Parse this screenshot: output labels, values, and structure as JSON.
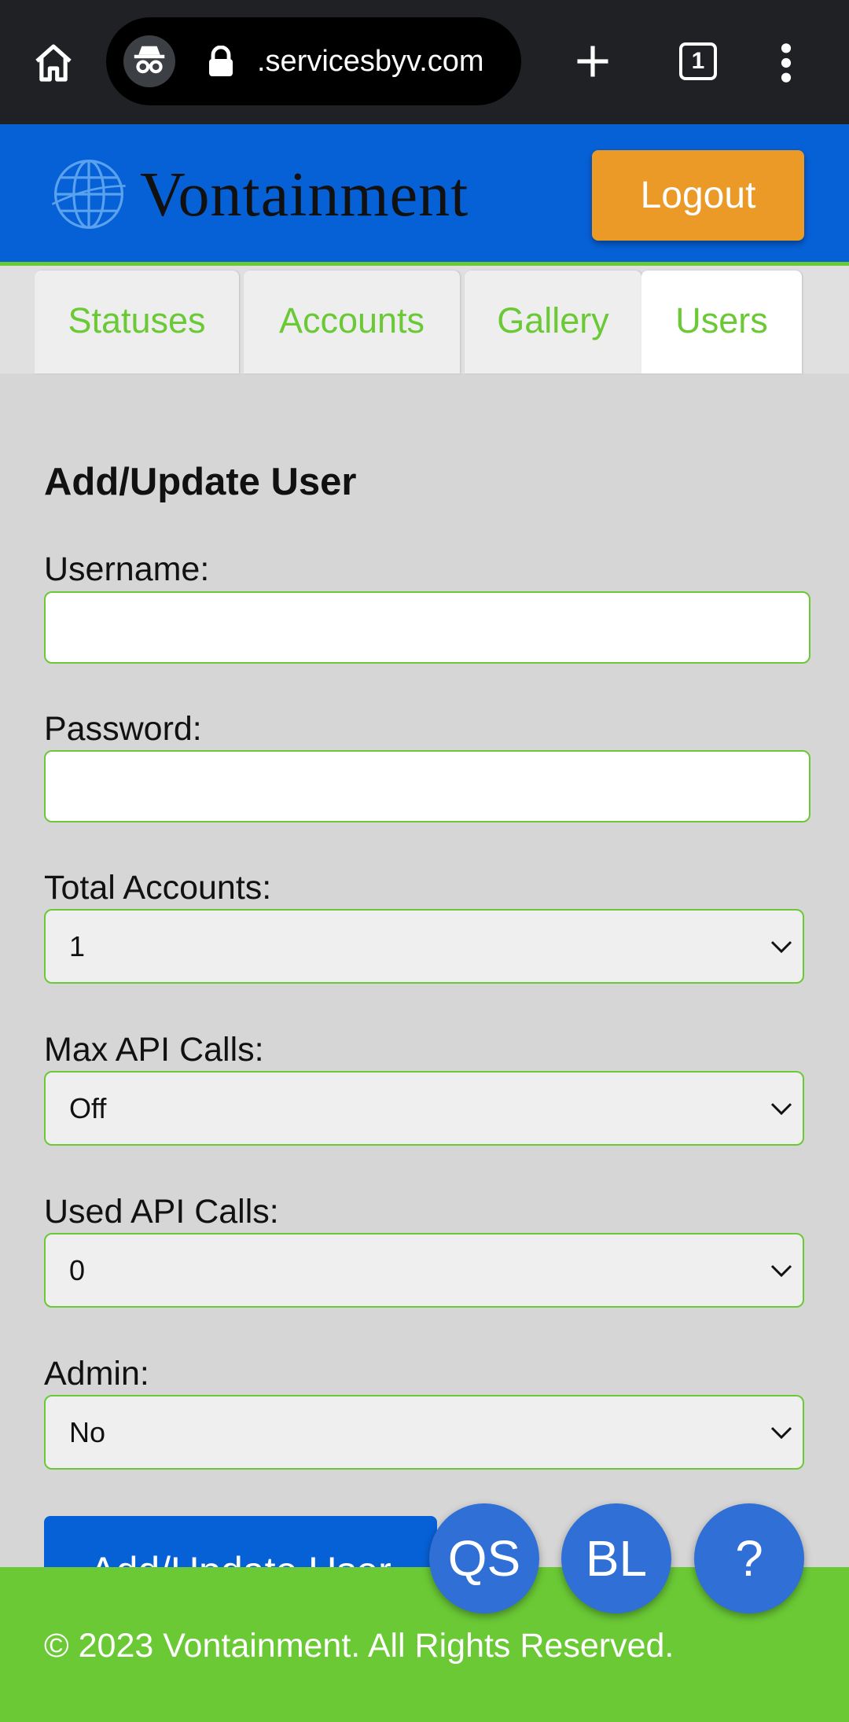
{
  "browser": {
    "url": ".servicesbyv.com",
    "tab_count": "1"
  },
  "header": {
    "logo_text": "Vontainment",
    "logout_label": "Logout"
  },
  "tabs": [
    {
      "label": "Statuses",
      "active": false
    },
    {
      "label": "Accounts",
      "active": false
    },
    {
      "label": "Gallery",
      "active": false
    },
    {
      "label": "Users",
      "active": true
    }
  ],
  "form": {
    "heading": "Add/Update User",
    "username_label": "Username:",
    "username_value": "",
    "password_label": "Password:",
    "password_value": "",
    "total_accounts_label": "Total Accounts:",
    "total_accounts_value": "1",
    "max_api_label": "Max API Calls:",
    "max_api_value": "Off",
    "used_api_label": "Used API Calls:",
    "used_api_value": "0",
    "admin_label": "Admin:",
    "admin_value": "No",
    "submit_label": "Add/Update User"
  },
  "fabs": {
    "qs": "QS",
    "bl": "BL",
    "help": "?"
  },
  "footer": {
    "copyright": "© 2023 Vontainment. All Rights Reserved."
  },
  "colors": {
    "brand_blue": "#0761d6",
    "accent_green": "#6ac935",
    "logout_orange": "#eb9a28",
    "fab_blue": "#2f6fd6"
  }
}
